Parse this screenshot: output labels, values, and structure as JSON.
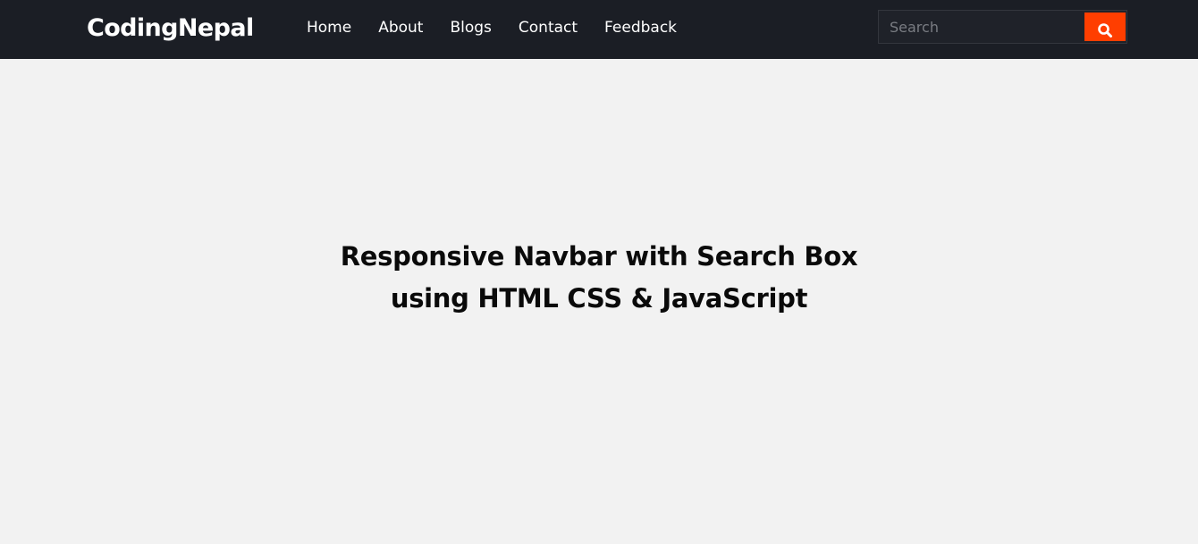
{
  "header": {
    "logo": "CodingNepal",
    "nav_items": [
      {
        "label": "Home"
      },
      {
        "label": "About"
      },
      {
        "label": "Blogs"
      },
      {
        "label": "Contact"
      },
      {
        "label": "Feedback"
      }
    ],
    "search": {
      "placeholder": "Search",
      "value": "",
      "button_icon": "search-icon",
      "button_color": "#ff3e00"
    },
    "background_color": "#1b1e25"
  },
  "main": {
    "title_lines": [
      "Responsive Navbar with Search Box",
      "using HTML CSS & JavaScript"
    ],
    "background_color": "#f2f2f2"
  }
}
